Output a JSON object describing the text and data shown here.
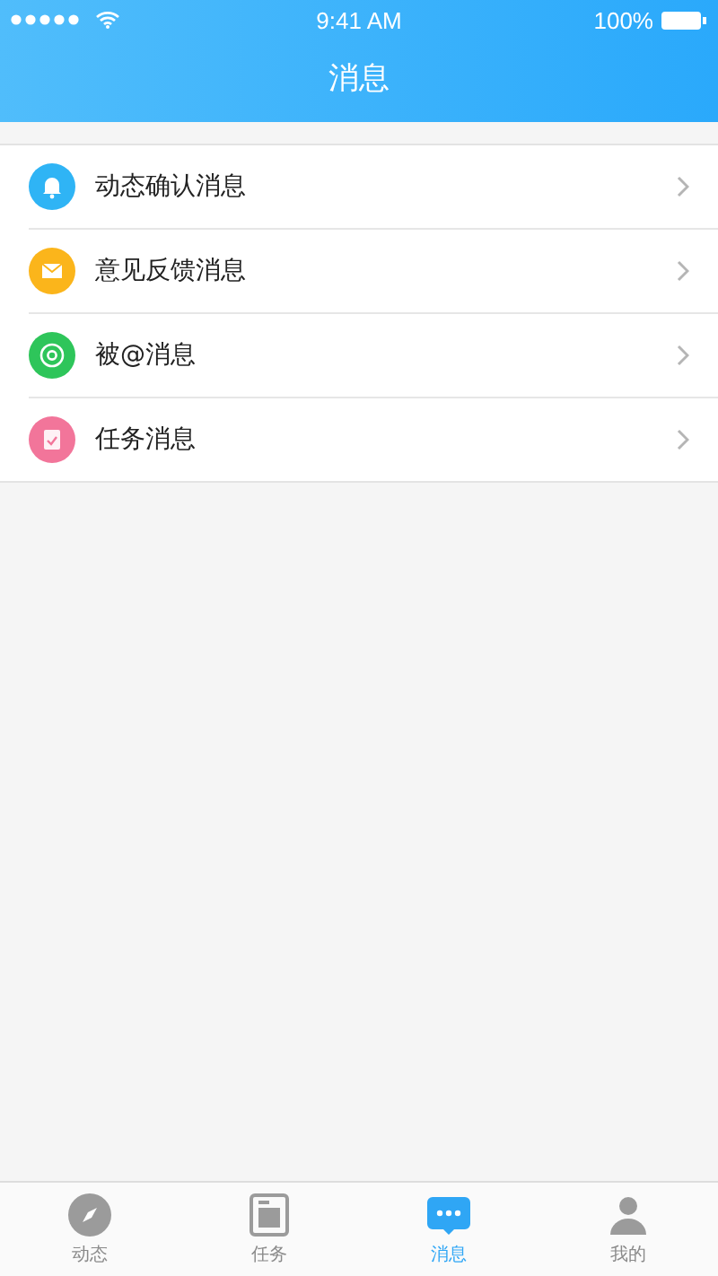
{
  "status_bar": {
    "time": "9:41 AM",
    "battery": "100%"
  },
  "nav_bar": {
    "title": "消息"
  },
  "messages": [
    {
      "label": "动态确认消息",
      "kind": "bell",
      "color": "#2fb4f5"
    },
    {
      "label": "意见反馈消息",
      "kind": "mail",
      "color": "#fbb51b"
    },
    {
      "label": "被@消息",
      "kind": "at",
      "color": "#2ec55a"
    },
    {
      "label": "任务消息",
      "kind": "task",
      "color": "#f2759a"
    }
  ],
  "tabs": [
    {
      "label": "动态",
      "kind": "compass",
      "selected": false
    },
    {
      "label": "任务",
      "kind": "task",
      "selected": false
    },
    {
      "label": "消息",
      "kind": "chat",
      "selected": true
    },
    {
      "label": "我的",
      "kind": "person",
      "selected": false
    }
  ]
}
